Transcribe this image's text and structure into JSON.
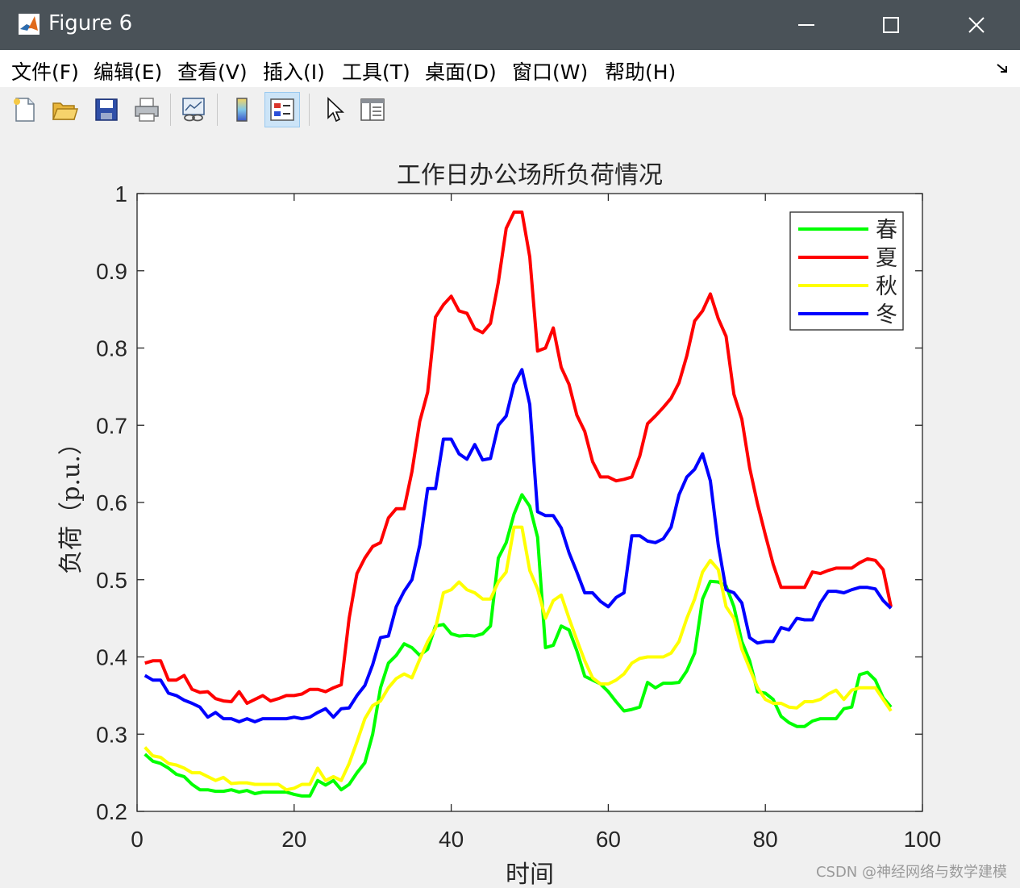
{
  "window": {
    "title": "Figure 6",
    "minimize_icon": "minimize-icon",
    "maximize_icon": "maximize-icon",
    "close_icon": "close-icon"
  },
  "menu": {
    "items": [
      "文件(F)",
      "编辑(E)",
      "查看(V)",
      "插入(I)",
      "工具(T)",
      "桌面(D)",
      "窗口(W)",
      "帮助(H)"
    ]
  },
  "toolbar": {
    "icons": [
      "new-figure-icon",
      "open-file-icon",
      "save-icon",
      "print-icon",
      "link-plot-icon",
      "colorbar-icon",
      "legend-icon",
      "pointer-icon",
      "property-inspector-icon"
    ]
  },
  "watermark": "CSDN @神经网络与数学建模",
  "chart_data": {
    "type": "line",
    "title": "工作日办公场所负荷情况",
    "xlabel": "时间",
    "ylabel": "负荷（p.u.）",
    "xlim": [
      0,
      100
    ],
    "ylim": [
      0.2,
      1
    ],
    "xticks": [
      0,
      20,
      40,
      60,
      80,
      100
    ],
    "yticks": [
      0.2,
      0.3,
      0.4,
      0.5,
      0.6,
      0.7,
      0.8,
      0.9,
      1
    ],
    "ytick_labels": [
      "0.2",
      "0.3",
      "0.4",
      "0.5",
      "0.6",
      "0.7",
      "0.8",
      "0.9",
      "1"
    ],
    "grid": false,
    "legend_position": "top-right",
    "series": [
      {
        "name": "春",
        "color": "#00ff00",
        "x": [
          1,
          2,
          3,
          4,
          5,
          6,
          7,
          8,
          9,
          10,
          11,
          12,
          13,
          14,
          15,
          16,
          17,
          18,
          19,
          20,
          21,
          22,
          23,
          24,
          25,
          26,
          27,
          28,
          29,
          30,
          31,
          32,
          33,
          34,
          35,
          36,
          37,
          38,
          39,
          40,
          41,
          42,
          43,
          44,
          45,
          46,
          47,
          48,
          49,
          50,
          51,
          52,
          53,
          54,
          55,
          56,
          57,
          58,
          59,
          60,
          61,
          62,
          63,
          64,
          65,
          66,
          67,
          68,
          69,
          70,
          71,
          72,
          73,
          74,
          75,
          76,
          77,
          78,
          79,
          80,
          81,
          82,
          83,
          84,
          85,
          86,
          87,
          88,
          89,
          90,
          91,
          92,
          93,
          94,
          95,
          96
        ],
        "y": [
          0.274,
          0.265,
          0.262,
          0.256,
          0.248,
          0.245,
          0.235,
          0.228,
          0.228,
          0.226,
          0.226,
          0.228,
          0.225,
          0.227,
          0.223,
          0.225,
          0.225,
          0.225,
          0.225,
          0.222,
          0.22,
          0.22,
          0.24,
          0.234,
          0.24,
          0.228,
          0.235,
          0.25,
          0.263,
          0.3,
          0.36,
          0.392,
          0.402,
          0.417,
          0.412,
          0.402,
          0.41,
          0.44,
          0.442,
          0.43,
          0.427,
          0.428,
          0.427,
          0.43,
          0.44,
          0.528,
          0.548,
          0.585,
          0.61,
          0.595,
          0.555,
          0.412,
          0.415,
          0.44,
          0.435,
          0.408,
          0.375,
          0.37,
          0.365,
          0.355,
          0.342,
          0.33,
          0.332,
          0.335,
          0.367,
          0.36,
          0.366,
          0.366,
          0.367,
          0.382,
          0.405,
          0.475,
          0.498,
          0.497,
          0.492,
          0.465,
          0.42,
          0.395,
          0.355,
          0.353,
          0.345,
          0.323,
          0.315,
          0.31,
          0.31,
          0.317,
          0.32,
          0.32,
          0.32,
          0.333,
          0.335,
          0.377,
          0.38,
          0.37,
          0.347,
          0.335
        ]
      },
      {
        "name": "夏",
        "color": "#ff0000",
        "x": [
          1,
          2,
          3,
          4,
          5,
          6,
          7,
          8,
          9,
          10,
          11,
          12,
          13,
          14,
          15,
          16,
          17,
          18,
          19,
          20,
          21,
          22,
          23,
          24,
          25,
          26,
          27,
          28,
          29,
          30,
          31,
          32,
          33,
          34,
          35,
          36,
          37,
          38,
          39,
          40,
          41,
          42,
          43,
          44,
          45,
          46,
          47,
          48,
          49,
          50,
          51,
          52,
          53,
          54,
          55,
          56,
          57,
          58,
          59,
          60,
          61,
          62,
          63,
          64,
          65,
          66,
          67,
          68,
          69,
          70,
          71,
          72,
          73,
          74,
          75,
          76,
          77,
          78,
          79,
          80,
          81,
          82,
          83,
          84,
          85,
          86,
          87,
          88,
          89,
          90,
          91,
          92,
          93,
          94,
          95,
          96
        ],
        "y": [
          0.392,
          0.395,
          0.395,
          0.37,
          0.37,
          0.376,
          0.358,
          0.354,
          0.355,
          0.346,
          0.343,
          0.342,
          0.355,
          0.34,
          0.345,
          0.35,
          0.343,
          0.346,
          0.35,
          0.35,
          0.352,
          0.358,
          0.358,
          0.355,
          0.36,
          0.364,
          0.45,
          0.508,
          0.528,
          0.543,
          0.548,
          0.58,
          0.592,
          0.592,
          0.64,
          0.705,
          0.743,
          0.84,
          0.856,
          0.867,
          0.848,
          0.845,
          0.825,
          0.82,
          0.832,
          0.885,
          0.955,
          0.976,
          0.976,
          0.918,
          0.796,
          0.8,
          0.826,
          0.775,
          0.753,
          0.713,
          0.692,
          0.653,
          0.633,
          0.633,
          0.628,
          0.63,
          0.633,
          0.66,
          0.702,
          0.712,
          0.723,
          0.735,
          0.755,
          0.79,
          0.835,
          0.848,
          0.87,
          0.838,
          0.815,
          0.74,
          0.708,
          0.645,
          0.598,
          0.558,
          0.52,
          0.49,
          0.49,
          0.49,
          0.49,
          0.51,
          0.508,
          0.512,
          0.515,
          0.515,
          0.515,
          0.522,
          0.527,
          0.525,
          0.513,
          0.465
        ]
      },
      {
        "name": "秋",
        "color": "#ffff00",
        "x": [
          1,
          2,
          3,
          4,
          5,
          6,
          7,
          8,
          9,
          10,
          11,
          12,
          13,
          14,
          15,
          16,
          17,
          18,
          19,
          20,
          21,
          22,
          23,
          24,
          25,
          26,
          27,
          28,
          29,
          30,
          31,
          32,
          33,
          34,
          35,
          36,
          37,
          38,
          39,
          40,
          41,
          42,
          43,
          44,
          45,
          46,
          47,
          48,
          49,
          50,
          51,
          52,
          53,
          54,
          55,
          56,
          57,
          58,
          59,
          60,
          61,
          62,
          63,
          64,
          65,
          66,
          67,
          68,
          69,
          70,
          71,
          72,
          73,
          74,
          75,
          76,
          77,
          78,
          79,
          80,
          81,
          82,
          83,
          84,
          85,
          86,
          87,
          88,
          89,
          90,
          91,
          92,
          93,
          94,
          95,
          96
        ],
        "y": [
          0.283,
          0.272,
          0.27,
          0.262,
          0.26,
          0.256,
          0.25,
          0.25,
          0.245,
          0.24,
          0.244,
          0.236,
          0.237,
          0.237,
          0.235,
          0.235,
          0.235,
          0.235,
          0.228,
          0.23,
          0.235,
          0.235,
          0.256,
          0.24,
          0.245,
          0.24,
          0.262,
          0.29,
          0.32,
          0.337,
          0.343,
          0.36,
          0.372,
          0.378,
          0.373,
          0.397,
          0.42,
          0.437,
          0.483,
          0.487,
          0.497,
          0.487,
          0.483,
          0.475,
          0.475,
          0.497,
          0.51,
          0.568,
          0.568,
          0.512,
          0.488,
          0.45,
          0.473,
          0.48,
          0.45,
          0.422,
          0.395,
          0.373,
          0.365,
          0.365,
          0.37,
          0.378,
          0.392,
          0.398,
          0.4,
          0.4,
          0.4,
          0.405,
          0.42,
          0.45,
          0.475,
          0.51,
          0.525,
          0.513,
          0.465,
          0.45,
          0.41,
          0.385,
          0.36,
          0.345,
          0.34,
          0.34,
          0.335,
          0.334,
          0.342,
          0.342,
          0.345,
          0.352,
          0.357,
          0.345,
          0.357,
          0.36,
          0.36,
          0.36,
          0.345,
          0.33
        ]
      },
      {
        "name": "冬",
        "color": "#0000ff",
        "x": [
          1,
          2,
          3,
          4,
          5,
          6,
          7,
          8,
          9,
          10,
          11,
          12,
          13,
          14,
          15,
          16,
          17,
          18,
          19,
          20,
          21,
          22,
          23,
          24,
          25,
          26,
          27,
          28,
          29,
          30,
          31,
          32,
          33,
          34,
          35,
          36,
          37,
          38,
          39,
          40,
          41,
          42,
          43,
          44,
          45,
          46,
          47,
          48,
          49,
          50,
          51,
          52,
          53,
          54,
          55,
          56,
          57,
          58,
          59,
          60,
          61,
          62,
          63,
          64,
          65,
          66,
          67,
          68,
          69,
          70,
          71,
          72,
          73,
          74,
          75,
          76,
          77,
          78,
          79,
          80,
          81,
          82,
          83,
          84,
          85,
          86,
          87,
          88,
          89,
          90,
          91,
          92,
          93,
          94,
          95,
          96
        ],
        "y": [
          0.376,
          0.37,
          0.37,
          0.353,
          0.35,
          0.344,
          0.34,
          0.335,
          0.322,
          0.328,
          0.32,
          0.32,
          0.316,
          0.32,
          0.316,
          0.32,
          0.32,
          0.32,
          0.32,
          0.322,
          0.32,
          0.322,
          0.328,
          0.333,
          0.322,
          0.333,
          0.334,
          0.35,
          0.363,
          0.39,
          0.425,
          0.427,
          0.465,
          0.485,
          0.5,
          0.545,
          0.618,
          0.618,
          0.682,
          0.682,
          0.663,
          0.656,
          0.675,
          0.655,
          0.657,
          0.7,
          0.712,
          0.753,
          0.772,
          0.727,
          0.588,
          0.583,
          0.583,
          0.567,
          0.535,
          0.51,
          0.483,
          0.483,
          0.472,
          0.465,
          0.477,
          0.483,
          0.557,
          0.557,
          0.55,
          0.548,
          0.553,
          0.568,
          0.61,
          0.633,
          0.643,
          0.663,
          0.628,
          0.545,
          0.487,
          0.483,
          0.47,
          0.425,
          0.418,
          0.42,
          0.42,
          0.438,
          0.435,
          0.45,
          0.448,
          0.448,
          0.47,
          0.485,
          0.485,
          0.483,
          0.487,
          0.49,
          0.49,
          0.488,
          0.473,
          0.463
        ]
      }
    ]
  }
}
